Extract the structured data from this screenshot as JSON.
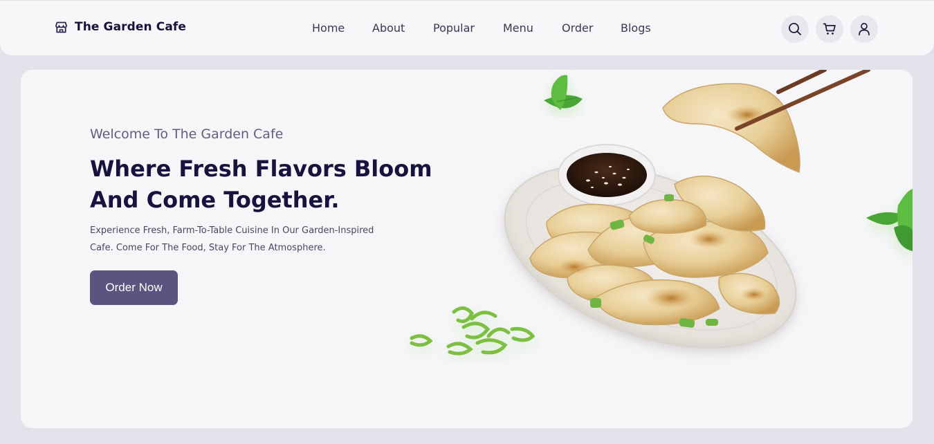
{
  "brand": {
    "name": "The Garden Cafe",
    "icon": "store-icon"
  },
  "nav": {
    "items": [
      {
        "label": "Home"
      },
      {
        "label": "About"
      },
      {
        "label": "Popular"
      },
      {
        "label": "Menu"
      },
      {
        "label": "Order"
      },
      {
        "label": "Blogs"
      }
    ]
  },
  "header_icons": [
    "search-icon",
    "cart-icon",
    "user-icon"
  ],
  "hero": {
    "welcome": "Welcome To The Garden Cafe",
    "headline_line1": "Where Fresh Flavors Bloom",
    "headline_line2": "And Come Together.",
    "description_line1": "Experience Fresh, Farm-To-Table Cuisine In Our Garden-Inspired",
    "description_line2": "Cafe. Come For The Food, Stay For The Atmosphere.",
    "cta_label": "Order Now",
    "image": "dumplings-plate-image"
  },
  "colors": {
    "page_bg": "#e3e1ea",
    "header_bg": "#f7f7f9",
    "hero_bg": "#f6f6f9",
    "heading": "#17133f",
    "accent_button": "#5c5480"
  }
}
